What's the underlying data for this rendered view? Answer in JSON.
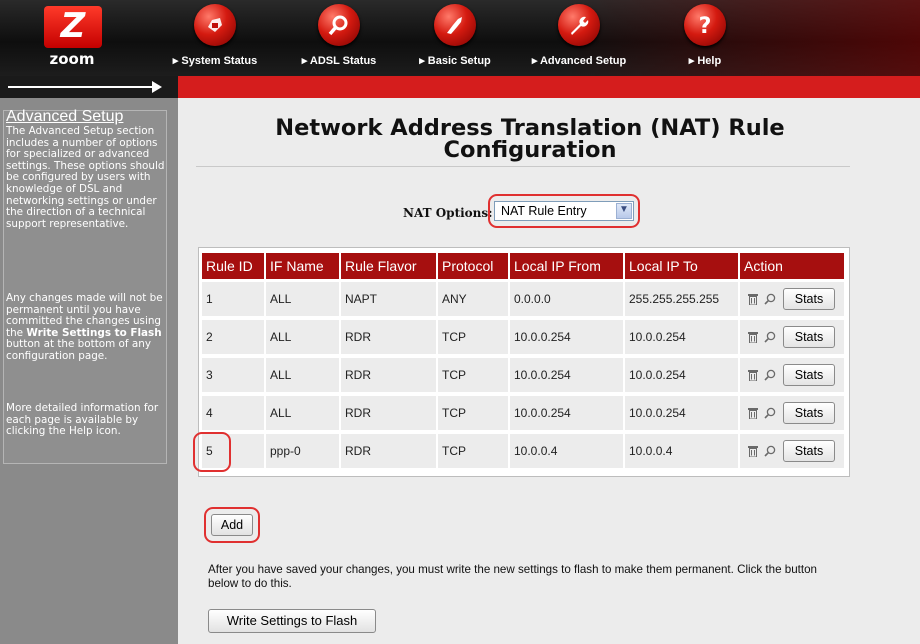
{
  "brand": {
    "logo_text": "zoom",
    "logo_letter": "Z"
  },
  "nav": [
    {
      "label": "▸ System Status",
      "icon": "status-icon"
    },
    {
      "label": "▸ ADSL Status",
      "icon": "magnifier-icon"
    },
    {
      "label": "▸ Basic Setup",
      "icon": "hand-icon"
    },
    {
      "label": "▸ Advanced Setup",
      "icon": "wrench-icon"
    },
    {
      "label": "▸ Help",
      "icon": "question-icon"
    }
  ],
  "sidebar": {
    "title": "Advanced Setup",
    "intro": "The Advanced Setup section includes a number of options for specialized or advanced settings. These options should be configured by users with knowledge of DSL and networking settings or under the direction of a technical support representative.",
    "warning_pre": "Any changes made will not be permanent until you have committed the changes using the ",
    "warning_bold": "Write Settings to Flash",
    "warning_post": " button at the bottom of any configuration page.",
    "more_info": "More detailed information for each page is available by clicking the Help icon."
  },
  "page": {
    "title_line1": "Network Address Translation (NAT) Rule",
    "title_line2": "Configuration"
  },
  "nat_options": {
    "label": "NAT Options:",
    "selected": "NAT Rule Entry"
  },
  "table": {
    "columns": [
      "Rule ID",
      "IF Name",
      "Rule Flavor",
      "Protocol",
      "Local IP From",
      "Local IP To",
      "Action"
    ],
    "rows": [
      [
        "1",
        "ALL",
        "NAPT",
        "ANY",
        "0.0.0.0",
        "255.255.255.255"
      ],
      [
        "2",
        "ALL",
        "RDR",
        "TCP",
        "10.0.0.254",
        "10.0.0.254"
      ],
      [
        "3",
        "ALL",
        "RDR",
        "TCP",
        "10.0.0.254",
        "10.0.0.254"
      ],
      [
        "4",
        "ALL",
        "RDR",
        "TCP",
        "10.0.0.254",
        "10.0.0.254"
      ],
      [
        "5",
        "ppp-0",
        "RDR",
        "TCP",
        "10.0.0.4",
        "10.0.0.4"
      ]
    ],
    "stats_label": "Stats"
  },
  "add_label": "Add",
  "flash_message": "After you have saved your changes, you must write the new settings to flash to make them permanent. Click the button below to do this.",
  "write_label": "Write Settings to Flash",
  "colors": {
    "header_red": "#d51d1d",
    "table_header": "#a60f0f",
    "highlight": "#e03030",
    "sidebar": "#8a8a8a"
  }
}
